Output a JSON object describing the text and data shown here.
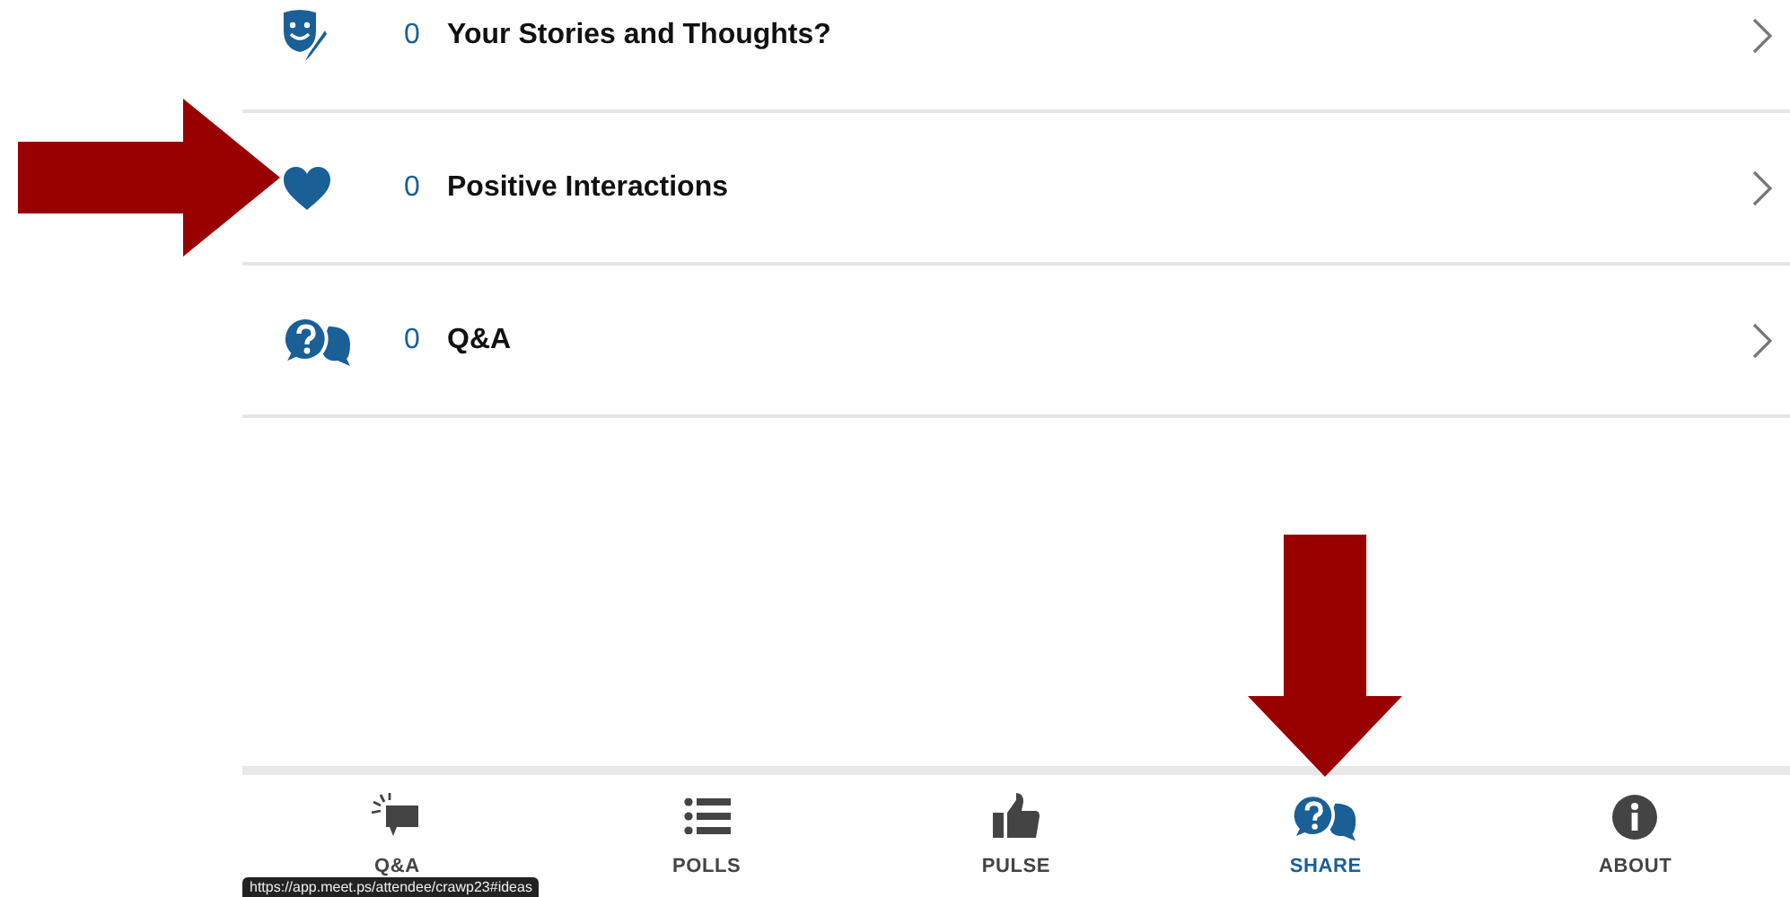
{
  "rows": [
    {
      "kind": "stories",
      "count": "0",
      "label": "Your Stories and Thoughts?"
    },
    {
      "kind": "heart",
      "count": "0",
      "label": "Positive Interactions"
    },
    {
      "kind": "qa",
      "count": "0",
      "label": "Q&A"
    }
  ],
  "nav": [
    {
      "kind": "qa",
      "label": "Q&A",
      "selected": false
    },
    {
      "kind": "polls",
      "label": "POLLS",
      "selected": false
    },
    {
      "kind": "pulse",
      "label": "PULSE",
      "selected": false
    },
    {
      "kind": "share",
      "label": "SHARE",
      "selected": true
    },
    {
      "kind": "about",
      "label": "ABOUT",
      "selected": false
    }
  ],
  "status_url": "https://app.meet.ps/attendee/crawp23#ideas"
}
